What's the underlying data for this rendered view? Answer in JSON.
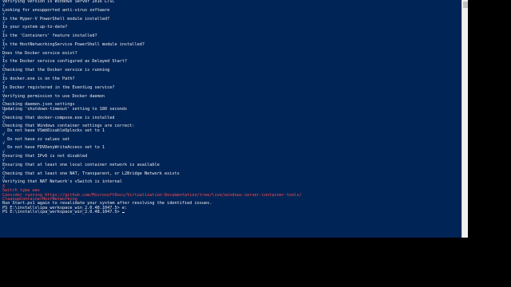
{
  "colors": {
    "console_bg": "#012456",
    "console_fg": "#eeedf0",
    "error_fg": "#ff4d4d",
    "outer_bg": "#000000"
  },
  "console": {
    "lines": [
      {
        "text": "Verifying version is Windows Server 2016 LTSC",
        "type": "normal"
      },
      {
        "text": "√",
        "type": "check"
      },
      {
        "text": "Looking for unsupported anti-virus software",
        "type": "normal"
      },
      {
        "text": "√",
        "type": "check"
      },
      {
        "text": "Is the Hyper-V PowerShell module installed?",
        "type": "normal"
      },
      {
        "text": "√",
        "type": "check"
      },
      {
        "text": "Is your system up-to-date?",
        "type": "normal"
      },
      {
        "text": "√",
        "type": "check"
      },
      {
        "text": "Is the 'Containers' feature installed?",
        "type": "normal"
      },
      {
        "text": "√",
        "type": "check"
      },
      {
        "text": "Is the HostNetworkingService PowerShell module installed?",
        "type": "normal"
      },
      {
        "text": "√",
        "type": "check"
      },
      {
        "text": "Does the Docker service exist?",
        "type": "normal"
      },
      {
        "text": "√",
        "type": "check"
      },
      {
        "text": "Is the Docker service configured as Delayed Start?",
        "type": "normal"
      },
      {
        "text": "√",
        "type": "check"
      },
      {
        "text": "Checking that the Docker service is running",
        "type": "normal"
      },
      {
        "text": "√",
        "type": "check"
      },
      {
        "text": "Is docker.exe is on the Path?",
        "type": "normal"
      },
      {
        "text": "√",
        "type": "check"
      },
      {
        "text": "Is Docker registered in the EventLog service?",
        "type": "normal"
      },
      {
        "text": "√",
        "type": "check"
      },
      {
        "text": "Verifying permission to use Docker daemon",
        "type": "normal"
      },
      {
        "text": "√",
        "type": "check"
      },
      {
        "text": "Checking daemon.json settings",
        "type": "normal"
      },
      {
        "text": "Updating 'shutdown-timeout' setting to 180 seconds",
        "type": "normal"
      },
      {
        "text": "√",
        "type": "check"
      },
      {
        "text": "Checking that docker-compose.exe is installed",
        "type": "normal"
      },
      {
        "text": "√",
        "type": "check"
      },
      {
        "text": "Checking that Windows container settings are correct:",
        "type": "normal"
      },
      {
        "text": "  Do not have VSmbDisableOplocks set to 1",
        "type": "normal"
      },
      {
        "text": "√",
        "type": "check"
      },
      {
        "text": "  Do not have zz values set",
        "type": "normal"
      },
      {
        "text": "√",
        "type": "check"
      },
      {
        "text": "  Do not have FDVDenyWriteAccess set to 1",
        "type": "normal"
      },
      {
        "text": "√",
        "type": "check"
      },
      {
        "text": "Ensuring that IPv6 is not disabled",
        "type": "normal"
      },
      {
        "text": "√",
        "type": "check"
      },
      {
        "text": "Ensuring that at least one local container network is available",
        "type": "normal"
      },
      {
        "text": "√",
        "type": "check"
      },
      {
        "text": "Checking that at least one NAT, Transparent, or L2Bridge Network exists",
        "type": "normal"
      },
      {
        "text": "√",
        "type": "check"
      },
      {
        "text": "Verifying that NAT Network's vSwitch is internal",
        "type": "normal"
      },
      {
        "text": "X",
        "type": "red"
      },
      {
        "text": "Switch type was",
        "type": "red"
      },
      {
        "text": "Consider running https://github.com/MicrosoftDocs/Virtualization-Documentation/tree/live/windows-server-container-tools/",
        "type": "red"
      },
      {
        "text": "CleanupContainerHostNetworking",
        "type": "red"
      },
      {
        "text": "Run Start.ps1 again to revalidate your system after resolving the identified issues.",
        "type": "normal"
      },
      {
        "text": "PS E:\\installs\\ipa_workspace_win_2.0.48.1047.5> e:",
        "type": "normal"
      },
      {
        "text": "PS E:\\installs\\ipa_workspace_win_2.0.48.1047.5> ",
        "type": "prompt"
      }
    ]
  }
}
